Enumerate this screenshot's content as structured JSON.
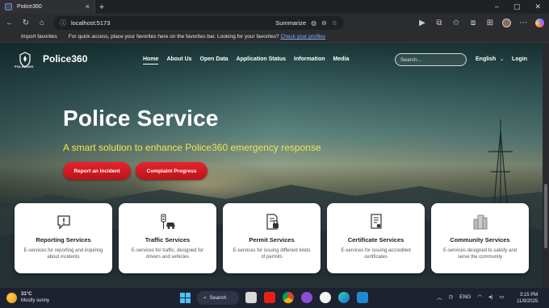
{
  "browser": {
    "tab_title": "Police360",
    "tab_close": "×",
    "new_tab": "+",
    "url": "localhost:5173",
    "summarize_label": "Summarize",
    "favorites_import": "Import favorites",
    "favorites_hint": "For quick access, place your favorites here on the favorites bar. Looking for your favorites?",
    "favorites_link": "Check your profiles"
  },
  "site": {
    "logo_sub": "POLICE360",
    "brand": "Police360",
    "nav": [
      "Home",
      "About Us",
      "Open Data",
      "Application Status",
      "Information",
      "Media"
    ],
    "search_placeholder": "Search...",
    "language": "English",
    "login": "Login"
  },
  "hero": {
    "title": "Police Service",
    "subtitle": "A smart solution to enhance Police360 emergency response",
    "btn_report": "Report an Incident",
    "btn_progress": "Complaint Progress",
    "subtitle_color": "#f1e64a",
    "button_color": "#d81f26"
  },
  "services": [
    {
      "icon": "alert-icon",
      "title": "Reporting Services",
      "desc": "E-services for reporting and inquiring about incidents"
    },
    {
      "icon": "traffic-icon",
      "title": "Traffic Services",
      "desc": "E-services for traffic, designed for drivers and vehicles"
    },
    {
      "icon": "permit-icon",
      "title": "Permit Services",
      "desc": "E-services for issuing different kinds of permits"
    },
    {
      "icon": "certificate-icon",
      "title": "Certificate Services",
      "desc": "E-services for issuing accredited certificates"
    },
    {
      "icon": "community-icon",
      "title": "Community Services",
      "desc": "E-services designed to satisfy and serve the community"
    }
  ],
  "taskbar": {
    "temp": "31°C",
    "weather": "Mostly sunny",
    "search": "Search",
    "lang": "ENG",
    "time": "3:15 PM",
    "date": "11/9/2025"
  }
}
